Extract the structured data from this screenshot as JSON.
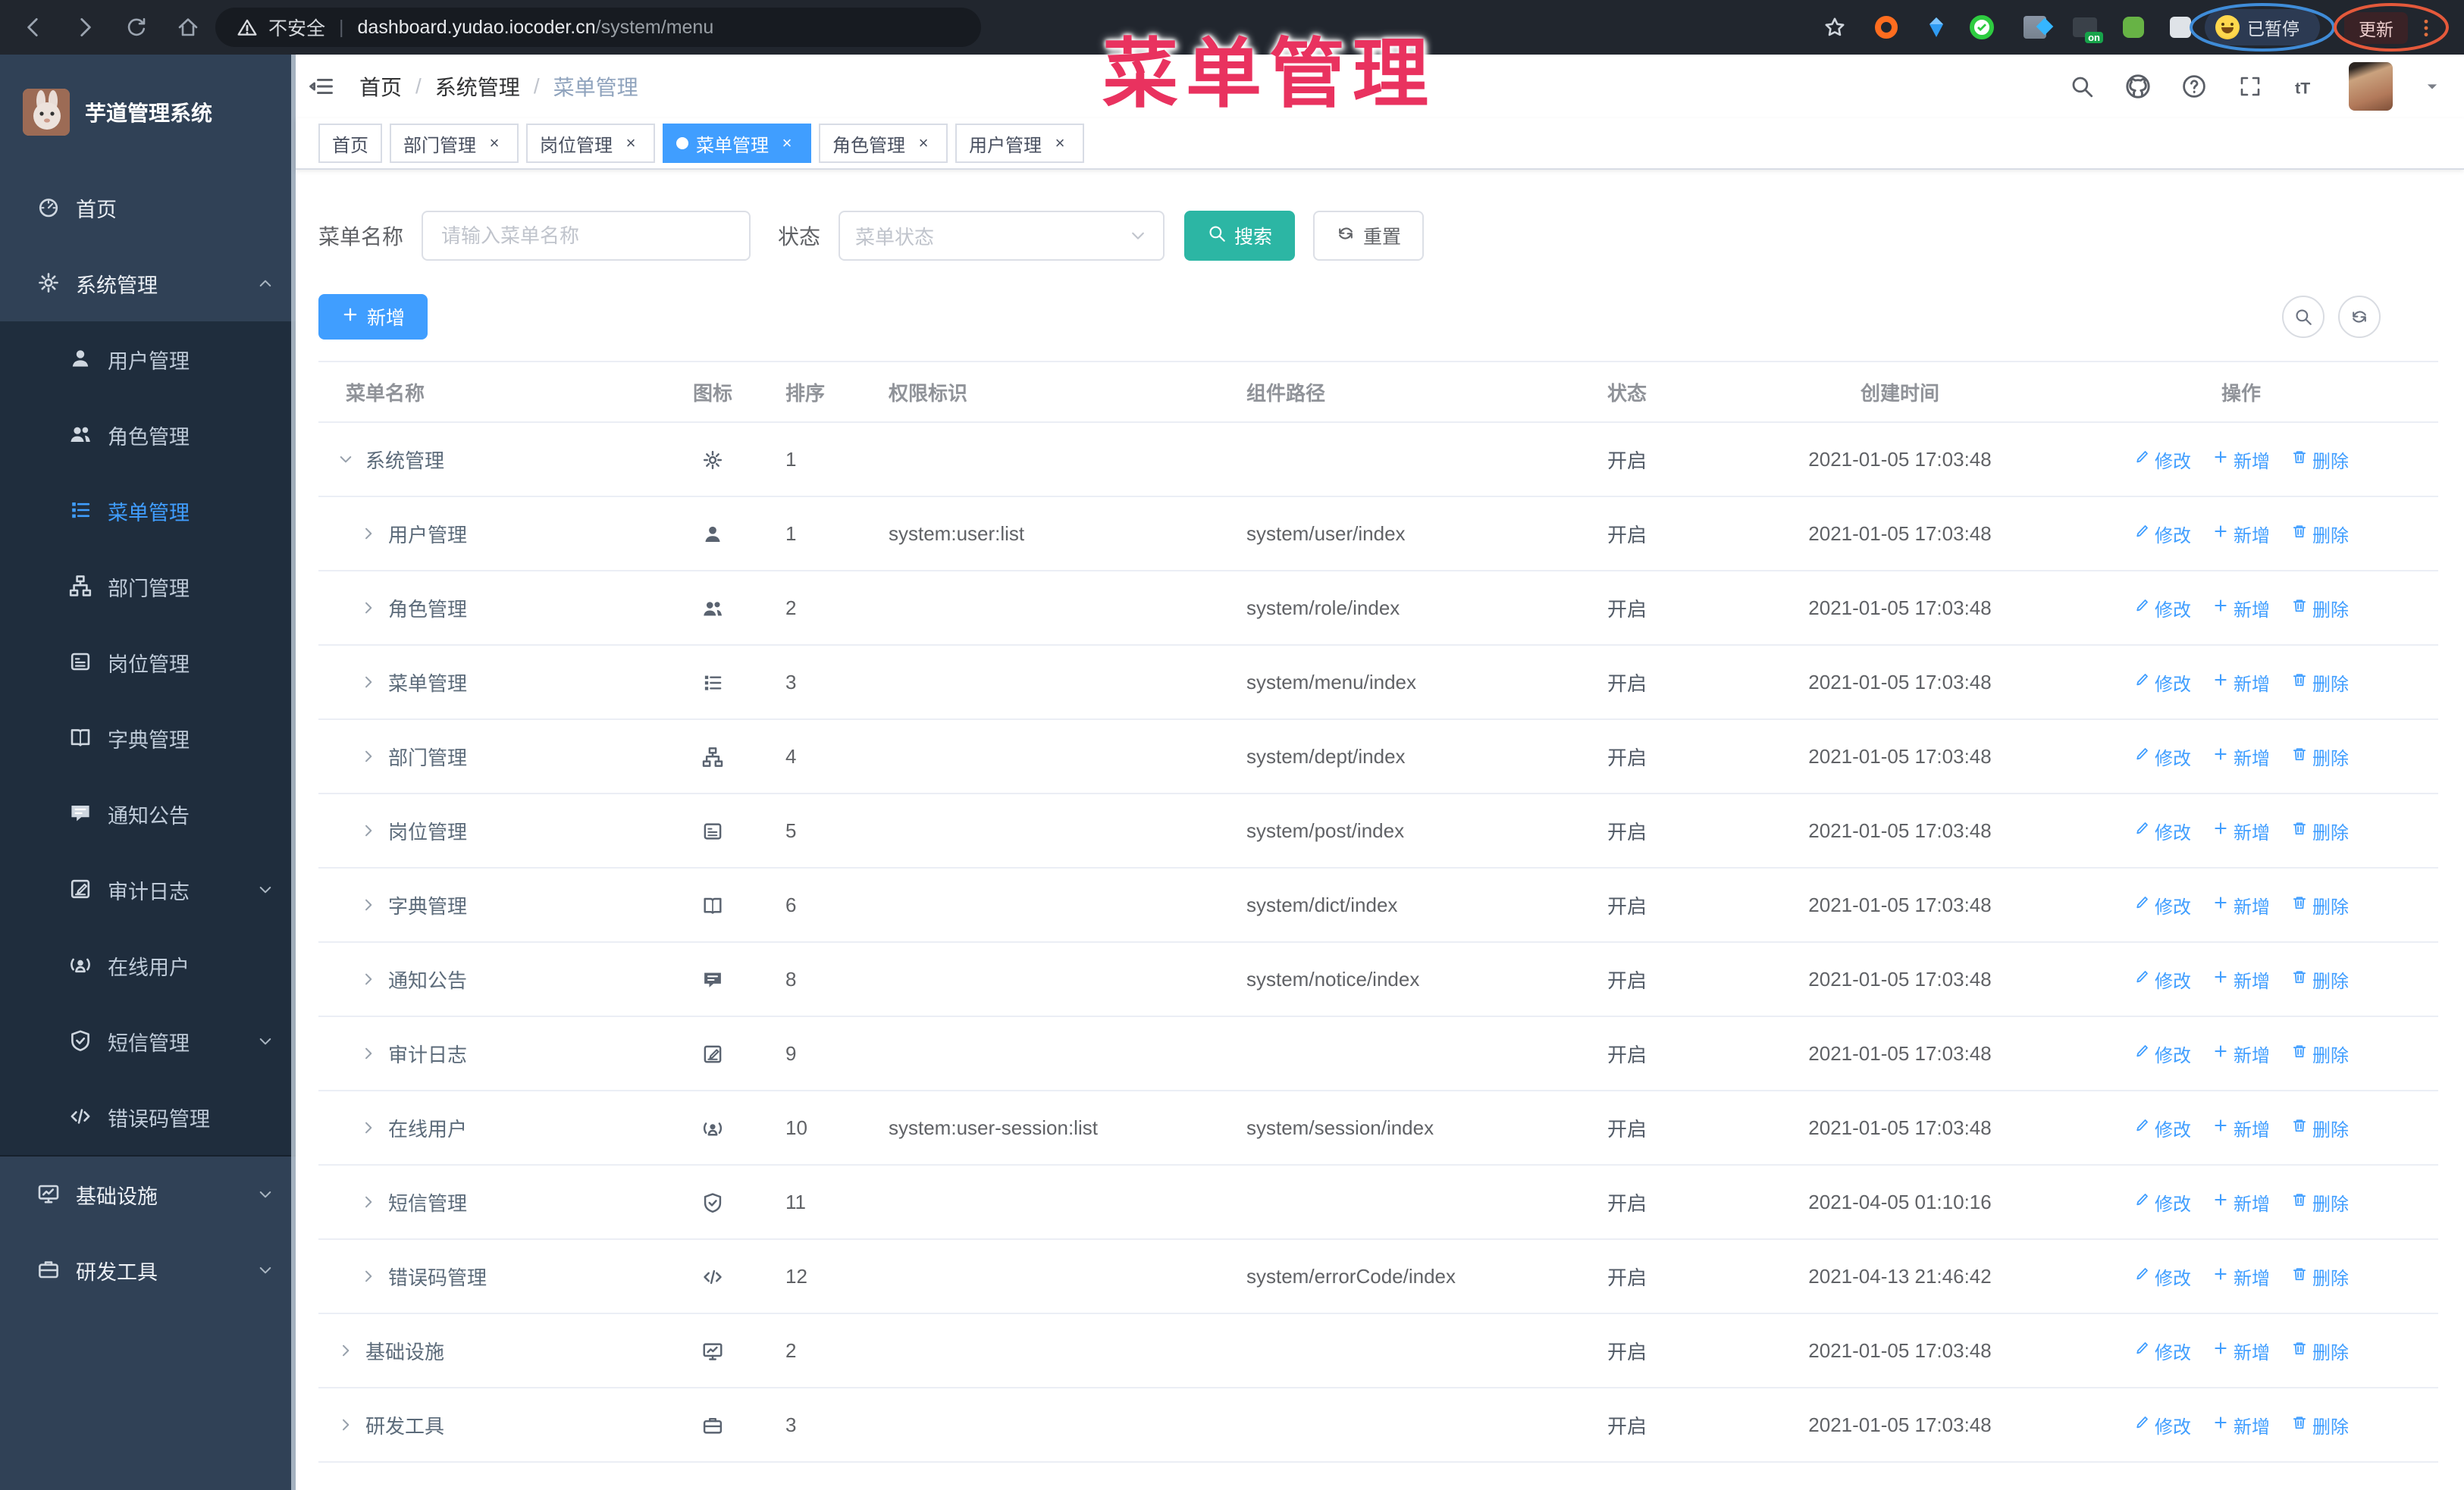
{
  "browser": {
    "security_label": "不安全",
    "url_host": "dashboard.yudao.iocoder.cn",
    "url_path": "/system/menu",
    "paused_label": "已暂停",
    "update_label": "更新",
    "extension_on_badge": "on",
    "extensions": [
      {
        "name": "bookmark-star-icon",
        "kind": "star"
      },
      {
        "name": "extension-adblock-icon",
        "kind": "ring"
      },
      {
        "name": "extension-gem-icon",
        "kind": "diamond"
      },
      {
        "name": "extension-verified-icon",
        "kind": "ring2"
      },
      {
        "name": "extension-grid-icon",
        "kind": "grid"
      },
      {
        "name": "extension-proxy-on-icon",
        "kind": "darksq"
      },
      {
        "name": "extension-bug-icon",
        "kind": "blob"
      },
      {
        "name": "extension-puzzle-icon",
        "kind": "puzzle"
      }
    ]
  },
  "annotation": {
    "title": "菜单管理"
  },
  "sidebar": {
    "logo_title": "芋道管理系统",
    "items": [
      {
        "label": "首页",
        "icon": "dashboard-icon",
        "level": 1
      },
      {
        "label": "系统管理",
        "icon": "gear-icon",
        "level": 1,
        "arrow": "up"
      },
      {
        "label": "用户管理",
        "icon": "user-icon",
        "level": 2
      },
      {
        "label": "角色管理",
        "icon": "users-icon",
        "level": 2
      },
      {
        "label": "菜单管理",
        "icon": "menu-icon",
        "level": 2,
        "active": true
      },
      {
        "label": "部门管理",
        "icon": "tree-icon",
        "level": 2
      },
      {
        "label": "岗位管理",
        "icon": "badge-icon",
        "level": 2
      },
      {
        "label": "字典管理",
        "icon": "book-icon",
        "level": 2
      },
      {
        "label": "通知公告",
        "icon": "message-icon",
        "level": 2
      },
      {
        "label": "审计日志",
        "icon": "log-icon",
        "level": 2,
        "arrow": "down"
      },
      {
        "label": "在线用户",
        "icon": "online-icon",
        "level": 2
      },
      {
        "label": "短信管理",
        "icon": "sms-icon",
        "level": 2,
        "arrow": "down"
      },
      {
        "label": "错误码管理",
        "icon": "code-icon",
        "level": 2
      },
      {
        "label": "基础设施",
        "icon": "infra-icon",
        "level": 1,
        "arrow": "down"
      },
      {
        "label": "研发工具",
        "icon": "tool-icon",
        "level": 1,
        "arrow": "down"
      }
    ]
  },
  "header": {
    "breadcrumb": [
      "首页",
      "系统管理",
      "菜单管理"
    ]
  },
  "tabs": [
    {
      "label": "首页",
      "closable": false,
      "active": false
    },
    {
      "label": "部门管理",
      "closable": true,
      "active": false
    },
    {
      "label": "岗位管理",
      "closable": true,
      "active": false
    },
    {
      "label": "菜单管理",
      "closable": true,
      "active": true
    },
    {
      "label": "角色管理",
      "closable": true,
      "active": false
    },
    {
      "label": "用户管理",
      "closable": true,
      "active": false
    }
  ],
  "filters": {
    "name_label": "菜单名称",
    "name_placeholder": "请输入菜单名称",
    "status_label": "状态",
    "status_placeholder": "菜单状态",
    "search_label": "搜索",
    "reset_label": "重置"
  },
  "toolbar": {
    "add_label": "新增"
  },
  "table": {
    "columns": [
      "菜单名称",
      "图标",
      "排序",
      "权限标识",
      "组件路径",
      "状态",
      "创建时间",
      "操作"
    ],
    "op_labels": [
      "修改",
      "新增",
      "删除"
    ],
    "rows": [
      {
        "name": "系统管理",
        "icon": "gear-icon",
        "expand": "down",
        "level": 1,
        "sort": "1",
        "perm": "",
        "path": "",
        "status": "开启",
        "time": "2021-01-05 17:03:48"
      },
      {
        "name": "用户管理",
        "icon": "user-icon",
        "expand": "right",
        "level": 2,
        "sort": "1",
        "perm": "system:user:list",
        "path": "system/user/index",
        "status": "开启",
        "time": "2021-01-05 17:03:48"
      },
      {
        "name": "角色管理",
        "icon": "users-icon",
        "expand": "right",
        "level": 2,
        "sort": "2",
        "perm": "",
        "path": "system/role/index",
        "status": "开启",
        "time": "2021-01-05 17:03:48"
      },
      {
        "name": "菜单管理",
        "icon": "menu-icon",
        "expand": "right",
        "level": 2,
        "sort": "3",
        "perm": "",
        "path": "system/menu/index",
        "status": "开启",
        "time": "2021-01-05 17:03:48"
      },
      {
        "name": "部门管理",
        "icon": "tree-icon",
        "expand": "right",
        "level": 2,
        "sort": "4",
        "perm": "",
        "path": "system/dept/index",
        "status": "开启",
        "time": "2021-01-05 17:03:48"
      },
      {
        "name": "岗位管理",
        "icon": "badge-icon",
        "expand": "right",
        "level": 2,
        "sort": "5",
        "perm": "",
        "path": "system/post/index",
        "status": "开启",
        "time": "2021-01-05 17:03:48"
      },
      {
        "name": "字典管理",
        "icon": "book-icon",
        "expand": "right",
        "level": 2,
        "sort": "6",
        "perm": "",
        "path": "system/dict/index",
        "status": "开启",
        "time": "2021-01-05 17:03:48"
      },
      {
        "name": "通知公告",
        "icon": "message-icon",
        "expand": "right",
        "level": 2,
        "sort": "8",
        "perm": "",
        "path": "system/notice/index",
        "status": "开启",
        "time": "2021-01-05 17:03:48"
      },
      {
        "name": "审计日志",
        "icon": "log-icon",
        "expand": "right",
        "level": 2,
        "sort": "9",
        "perm": "",
        "path": "",
        "status": "开启",
        "time": "2021-01-05 17:03:48"
      },
      {
        "name": "在线用户",
        "icon": "online-icon",
        "expand": "right",
        "level": 2,
        "sort": "10",
        "perm": "system:user-session:list",
        "path": "system/session/index",
        "status": "开启",
        "time": "2021-01-05 17:03:48"
      },
      {
        "name": "短信管理",
        "icon": "sms-icon",
        "expand": "right",
        "level": 2,
        "sort": "11",
        "perm": "",
        "path": "",
        "status": "开启",
        "time": "2021-04-05 01:10:16"
      },
      {
        "name": "错误码管理",
        "icon": "code-icon",
        "expand": "right",
        "level": 2,
        "sort": "12",
        "perm": "",
        "path": "system/errorCode/index",
        "status": "开启",
        "time": "2021-04-13 21:46:42"
      },
      {
        "name": "基础设施",
        "icon": "infra-icon",
        "expand": "right",
        "level": 1,
        "sort": "2",
        "perm": "",
        "path": "",
        "status": "开启",
        "time": "2021-01-05 17:03:48"
      },
      {
        "name": "研发工具",
        "icon": "tool-icon",
        "expand": "right",
        "level": 1,
        "sort": "3",
        "perm": "",
        "path": "",
        "status": "开启",
        "time": "2021-01-05 17:03:48"
      }
    ]
  },
  "colors": {
    "primary": "#409eff",
    "search_button": "#2cb6a4",
    "annotation": "#e9325f",
    "sidebar_bg": "#304156",
    "submenu_bg": "#1f2d3d",
    "active_tab": "#409eff"
  }
}
